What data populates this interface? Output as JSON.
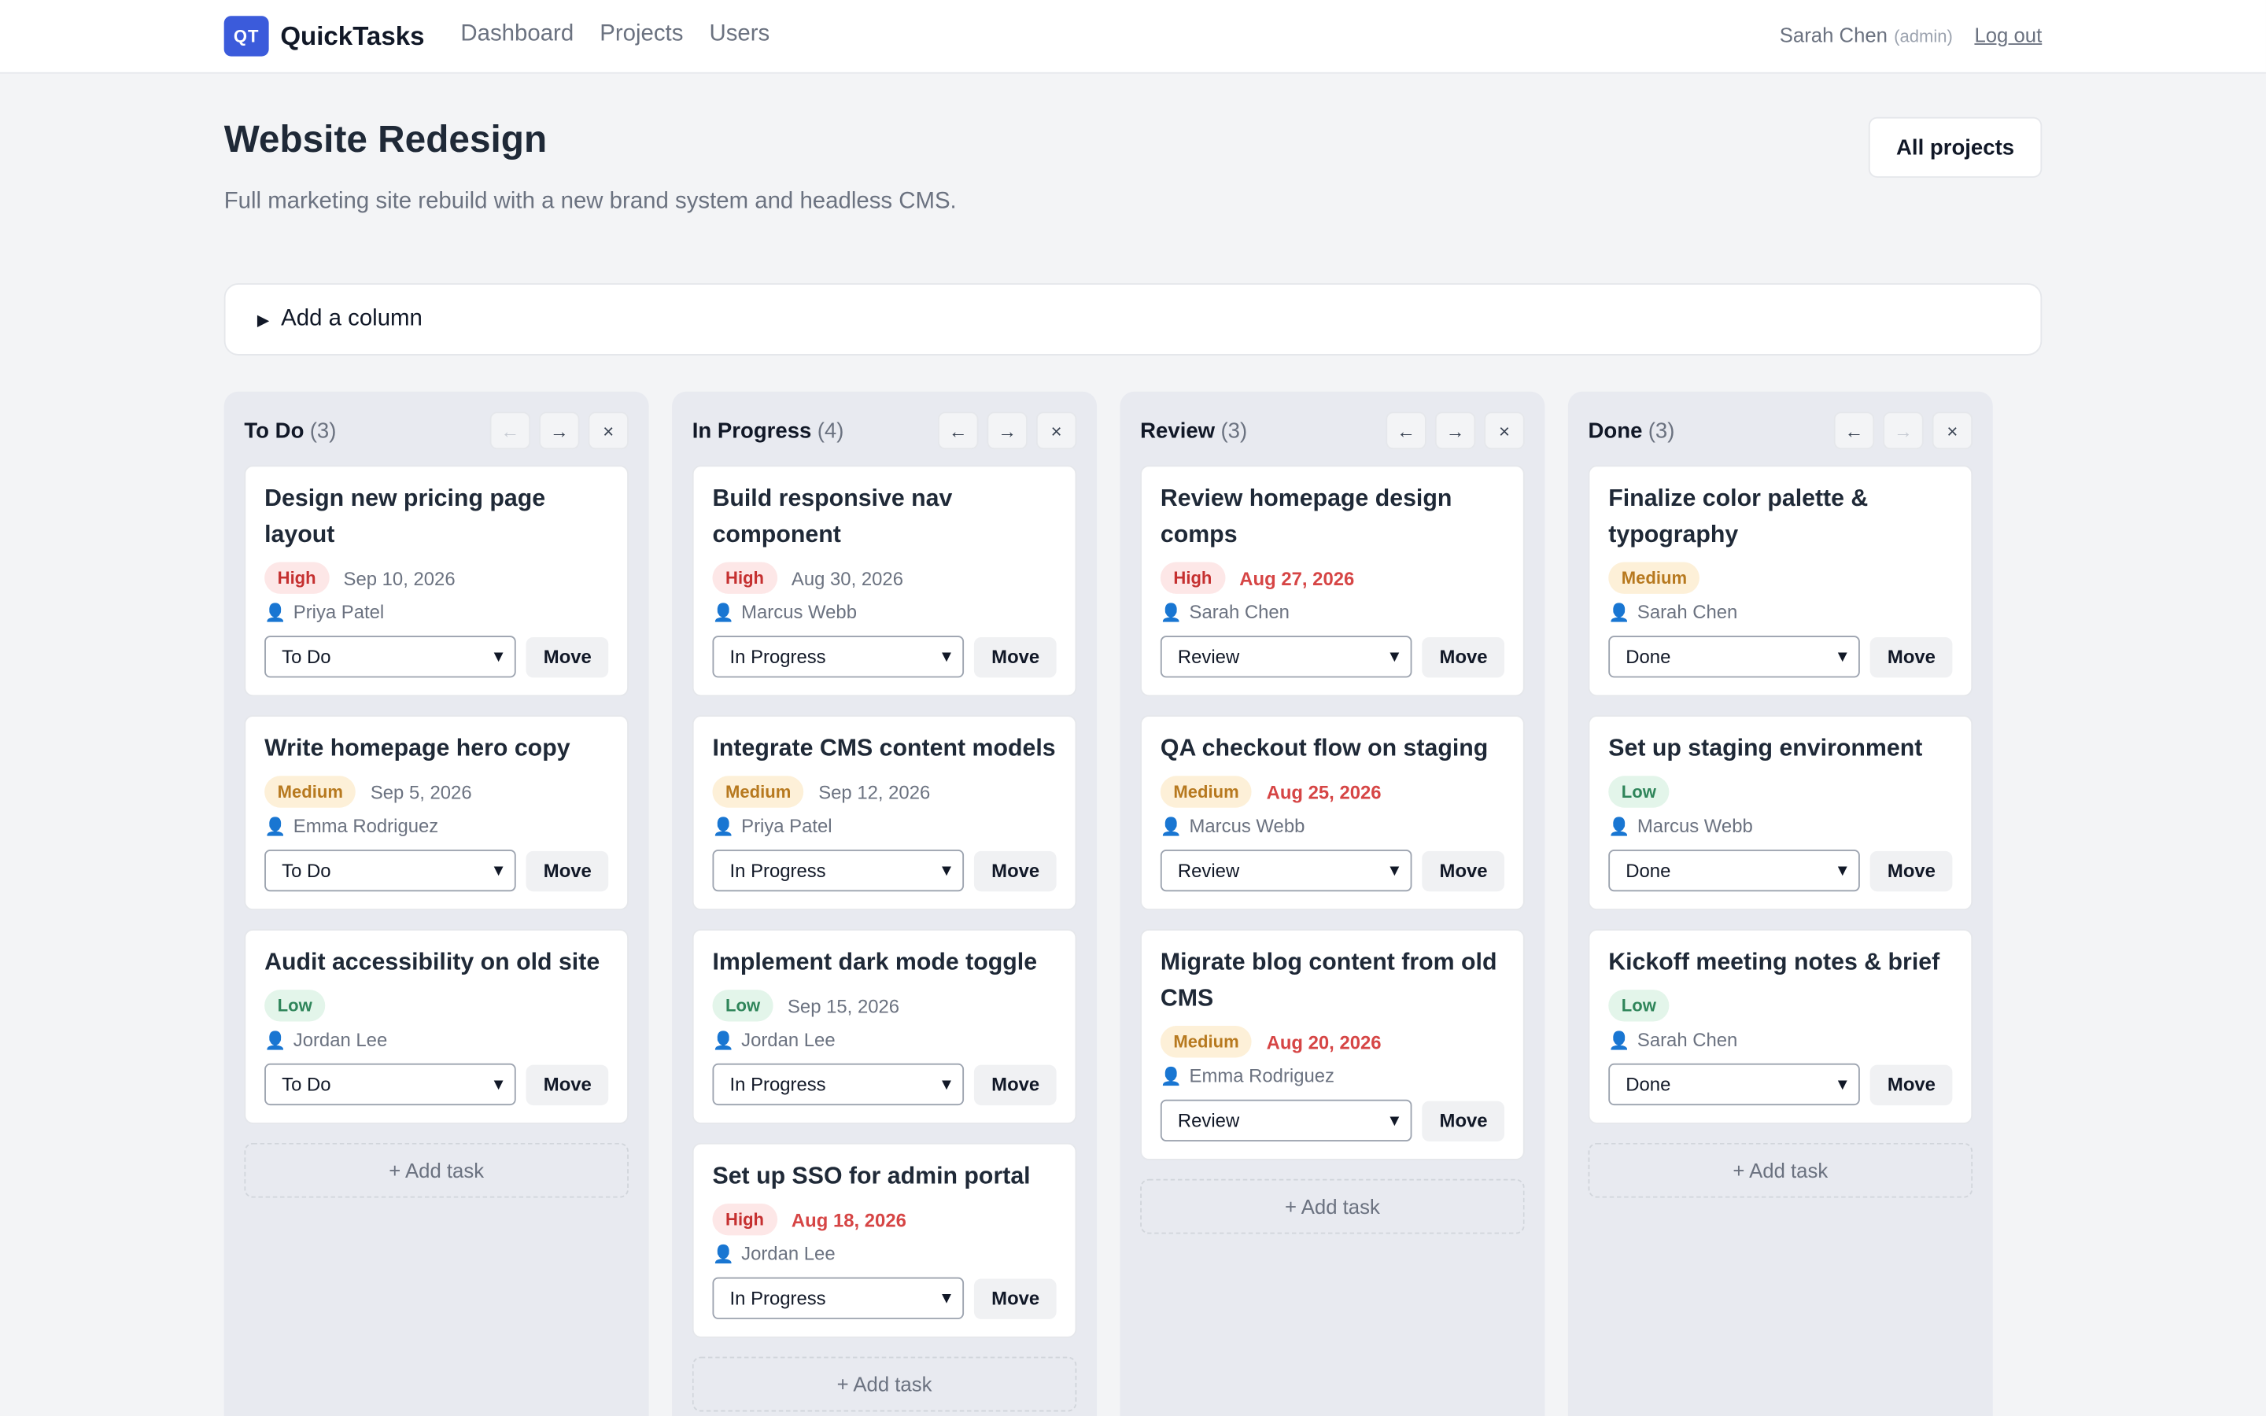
{
  "nav": {
    "logo_text": "QT",
    "app_name": "QuickTasks",
    "links": [
      "Dashboard",
      "Projects",
      "Users"
    ],
    "user_name": "Sarah Chen",
    "user_role": "(admin)",
    "logout": "Log out"
  },
  "project": {
    "title": "Website Redesign",
    "description": "Full marketing site rebuild with a new brand system and headless CMS.",
    "all_projects_label": "All projects",
    "add_column_label": "Add a column"
  },
  "labels": {
    "move": "Move",
    "add_task": "+ Add task",
    "arrow_left": "←",
    "arrow_right": "→",
    "close": "×"
  },
  "columns": [
    {
      "title": "To Do",
      "count": "(3)",
      "left_disabled": true,
      "right_disabled": false,
      "tasks": [
        {
          "title": "Design new pricing page layout",
          "priority": "High",
          "priority_level": "high",
          "date": "Sep 10, 2026",
          "overdue": false,
          "assignee": "Priya Patel",
          "status": "To Do"
        },
        {
          "title": "Write homepage hero copy",
          "priority": "Medium",
          "priority_level": "medium",
          "date": "Sep 5, 2026",
          "overdue": false,
          "assignee": "Emma Rodriguez",
          "status": "To Do"
        },
        {
          "title": "Audit accessibility on old site",
          "priority": "Low",
          "priority_level": "low",
          "date": "",
          "overdue": false,
          "assignee": "Jordan Lee",
          "status": "To Do"
        }
      ]
    },
    {
      "title": "In Progress",
      "count": "(4)",
      "left_disabled": false,
      "right_disabled": false,
      "tasks": [
        {
          "title": "Build responsive nav component",
          "priority": "High",
          "priority_level": "high",
          "date": "Aug 30, 2026",
          "overdue": false,
          "assignee": "Marcus Webb",
          "status": "In Progress"
        },
        {
          "title": "Integrate CMS content models",
          "priority": "Medium",
          "priority_level": "medium",
          "date": "Sep 12, 2026",
          "overdue": false,
          "assignee": "Priya Patel",
          "status": "In Progress"
        },
        {
          "title": "Implement dark mode toggle",
          "priority": "Low",
          "priority_level": "low",
          "date": "Sep 15, 2026",
          "overdue": false,
          "assignee": "Jordan Lee",
          "status": "In Progress"
        },
        {
          "title": "Set up SSO for admin portal",
          "priority": "High",
          "priority_level": "high",
          "date": "Aug 18, 2026",
          "overdue": true,
          "assignee": "Jordan Lee",
          "status": "In Progress"
        }
      ]
    },
    {
      "title": "Review",
      "count": "(3)",
      "left_disabled": false,
      "right_disabled": false,
      "tasks": [
        {
          "title": "Review homepage design comps",
          "priority": "High",
          "priority_level": "high",
          "date": "Aug 27, 2026",
          "overdue": true,
          "assignee": "Sarah Chen",
          "status": "Review"
        },
        {
          "title": "QA checkout flow on staging",
          "priority": "Medium",
          "priority_level": "medium",
          "date": "Aug 25, 2026",
          "overdue": true,
          "assignee": "Marcus Webb",
          "status": "Review"
        },
        {
          "title": "Migrate blog content from old CMS",
          "priority": "Medium",
          "priority_level": "medium",
          "date": "Aug 20, 2026",
          "overdue": true,
          "assignee": "Emma Rodriguez",
          "status": "Review"
        }
      ]
    },
    {
      "title": "Done",
      "count": "(3)",
      "left_disabled": false,
      "right_disabled": true,
      "tasks": [
        {
          "title": "Finalize color palette & typography",
          "priority": "Medium",
          "priority_level": "medium",
          "date": "",
          "overdue": false,
          "assignee": "Sarah Chen",
          "status": "Done"
        },
        {
          "title": "Set up staging environment",
          "priority": "Low",
          "priority_level": "low",
          "date": "",
          "overdue": false,
          "assignee": "Marcus Webb",
          "status": "Done"
        },
        {
          "title": "Kickoff meeting notes & brief",
          "priority": "Low",
          "priority_level": "low",
          "date": "",
          "overdue": false,
          "assignee": "Sarah Chen",
          "status": "Done"
        }
      ]
    }
  ]
}
